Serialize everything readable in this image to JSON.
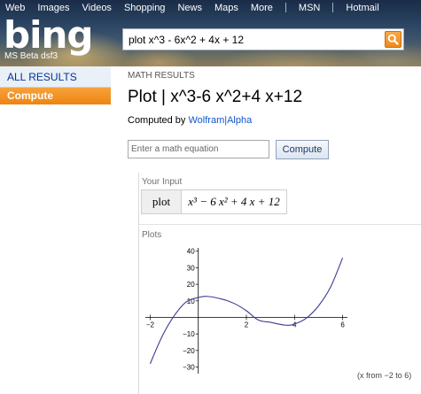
{
  "topnav": {
    "items": [
      "Web",
      "Images",
      "Videos",
      "Shopping",
      "News",
      "Maps",
      "More"
    ],
    "right_items": [
      "MSN",
      "Hotmail"
    ]
  },
  "logo": {
    "text": "bing",
    "subtitle": "MS Beta dsf3"
  },
  "search": {
    "value": "plot x^3 - 6x^2 + 4x + 12",
    "button_icon": "magnifier-icon"
  },
  "sidebar": {
    "all_results": "ALL RESULTS",
    "compute": "Compute"
  },
  "main": {
    "section_label": "MATH RESULTS",
    "title": "Plot | x^3-6 x^2+4 x+12",
    "computed_by_prefix": "Computed by ",
    "computed_by_link": "Wolfram|Alpha",
    "input_placeholder": "Enter a math equation",
    "compute_button": "Compute"
  },
  "wolfram": {
    "input_pod_title": "Your Input",
    "input_keyword": "plot",
    "input_expr": "x³ − 6 x² + 4 x + 12",
    "plots_pod_title": "Plots",
    "range_note": "(x from −2 to 6)"
  },
  "colors": {
    "accent_orange": "#ee8411",
    "curve": "#3c3c96",
    "link": "#1155cc"
  },
  "chart_data": {
    "type": "line",
    "function": "x^3 - 6x^2 + 4x + 12",
    "x_ticks": [
      -2,
      2,
      4,
      6
    ],
    "y_ticks": [
      -30,
      -20,
      -10,
      10,
      20,
      30,
      40
    ],
    "xlim": [
      -2.2,
      6.2
    ],
    "ylim": [
      -34,
      42
    ],
    "series": [
      {
        "x": [
          -2,
          -1.5,
          -1,
          -0.5,
          0,
          0.37,
          1,
          1.5,
          2,
          2.5,
          3,
          3.63,
          4,
          4.5,
          5,
          5.5,
          6
        ],
        "y": [
          -28,
          -11.38,
          1,
          9.38,
          12,
          12.7,
          11,
          8.38,
          4,
          -1.63,
          -3,
          -4.7,
          -4,
          -0.38,
          7,
          18.38,
          36
        ]
      }
    ]
  }
}
